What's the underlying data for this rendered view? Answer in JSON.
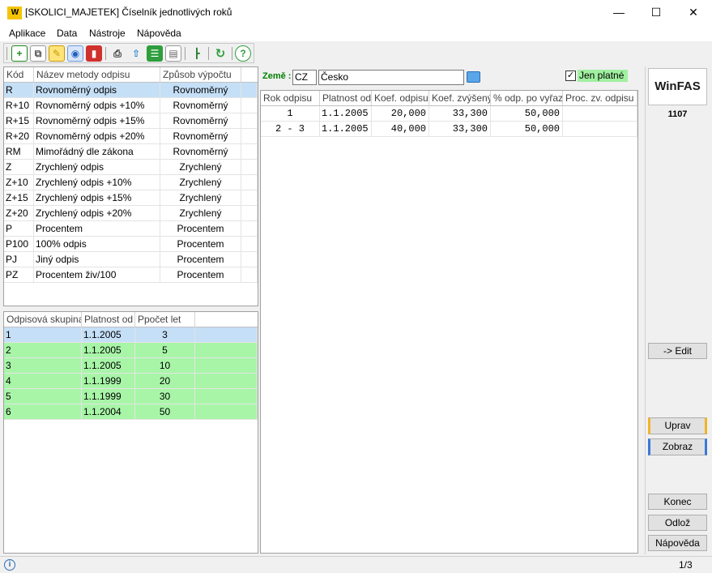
{
  "window": {
    "title": "[SKOLICI_MAJETEK] Číselník jednotlivých roků",
    "logo": "W",
    "controls": {
      "minimize": "—",
      "maximize": "☐",
      "close": "✕"
    }
  },
  "menu": [
    "Aplikace",
    "Data",
    "Nástroje",
    "Nápověda"
  ],
  "toolbar_icons": [
    "add-icon",
    "copy-icon",
    "edit-icon",
    "view-icon",
    "delete-icon",
    "print-icon",
    "export-icon",
    "list-icon",
    "panel-icon",
    "tree-icon",
    "refresh-icon",
    "help-icon"
  ],
  "methods": {
    "headers": [
      "Kód",
      "Název metody odpisu",
      "Způsob výpočtu"
    ],
    "rows": [
      [
        "R",
        "Rovnoměrný odpis",
        "Rovnoměrný"
      ],
      [
        "R+10",
        "Rovnoměrný odpis +10%",
        "Rovnoměrný"
      ],
      [
        "R+15",
        "Rovnoměrný odpis +15%",
        "Rovnoměrný"
      ],
      [
        "R+20",
        "Rovnoměrný odpis +20%",
        "Rovnoměrný"
      ],
      [
        "RM",
        "Mimořádný dle zákona",
        "Rovnoměrný"
      ],
      [
        "Z",
        "Zrychlený odpis",
        "Zrychlený"
      ],
      [
        "Z+10",
        "Zrychlený odpis +10%",
        "Zrychlený"
      ],
      [
        "Z+15",
        "Zrychlený odpis +15%",
        "Zrychlený"
      ],
      [
        "Z+20",
        "Zrychlený odpis +20%",
        "Zrychlený"
      ],
      [
        "P",
        "Procentem",
        "Procentem"
      ],
      [
        "P100",
        "100% odpis",
        "Procentem"
      ],
      [
        "PJ",
        "Jiný odpis",
        "Procentem"
      ],
      [
        "PZ",
        "Procentem živ/100",
        "Procentem"
      ]
    ]
  },
  "groups": {
    "headers": [
      "Odpisová skupina",
      "Platnost od",
      "Ppočet let"
    ],
    "rows": [
      [
        "1",
        "1.1.2005",
        "3"
      ],
      [
        "2",
        "1.1.2005",
        "5"
      ],
      [
        "3",
        "1.1.2005",
        "10"
      ],
      [
        "4",
        "1.1.1999",
        "20"
      ],
      [
        "5",
        "1.1.1999",
        "30"
      ],
      [
        "6",
        "1.1.2004",
        "50"
      ]
    ]
  },
  "filter": {
    "country_label": "Země :",
    "country_code": "CZ",
    "country_name": "Česko",
    "only_valid_label": "Jen platné",
    "only_valid_checked": true
  },
  "years": {
    "headers": [
      "Rok odpisu",
      "Platnost od",
      "Koef. odpisu",
      "Koef. zvýšený",
      "% odp. po vyřaz.",
      "Proc. zv. odpisu"
    ],
    "rows": [
      [
        "1",
        "1.1.2005",
        "20,000",
        "33,300",
        "50,000",
        ""
      ],
      [
        "2 - 3",
        "1.1.2005",
        "40,000",
        "33,300",
        "50,000",
        ""
      ]
    ]
  },
  "side": {
    "brand": "WinFAS",
    "number": "1107",
    "edit_button": "-> Edit",
    "uprav": "Uprav",
    "zobraz": "Zobraz",
    "konec": "Konec",
    "odloz": "Odlož",
    "napoveda": "Nápověda"
  },
  "status": {
    "info": "i",
    "page": "1/3"
  },
  "colors": {
    "selected_row": "#c5dff7",
    "green_row": "#a8f5a8",
    "checkbox_highlight": "#a0f0a0",
    "label_green": "#008000",
    "uprav_accent": "#f0b429",
    "zobraz_accent": "#3b78d8"
  }
}
